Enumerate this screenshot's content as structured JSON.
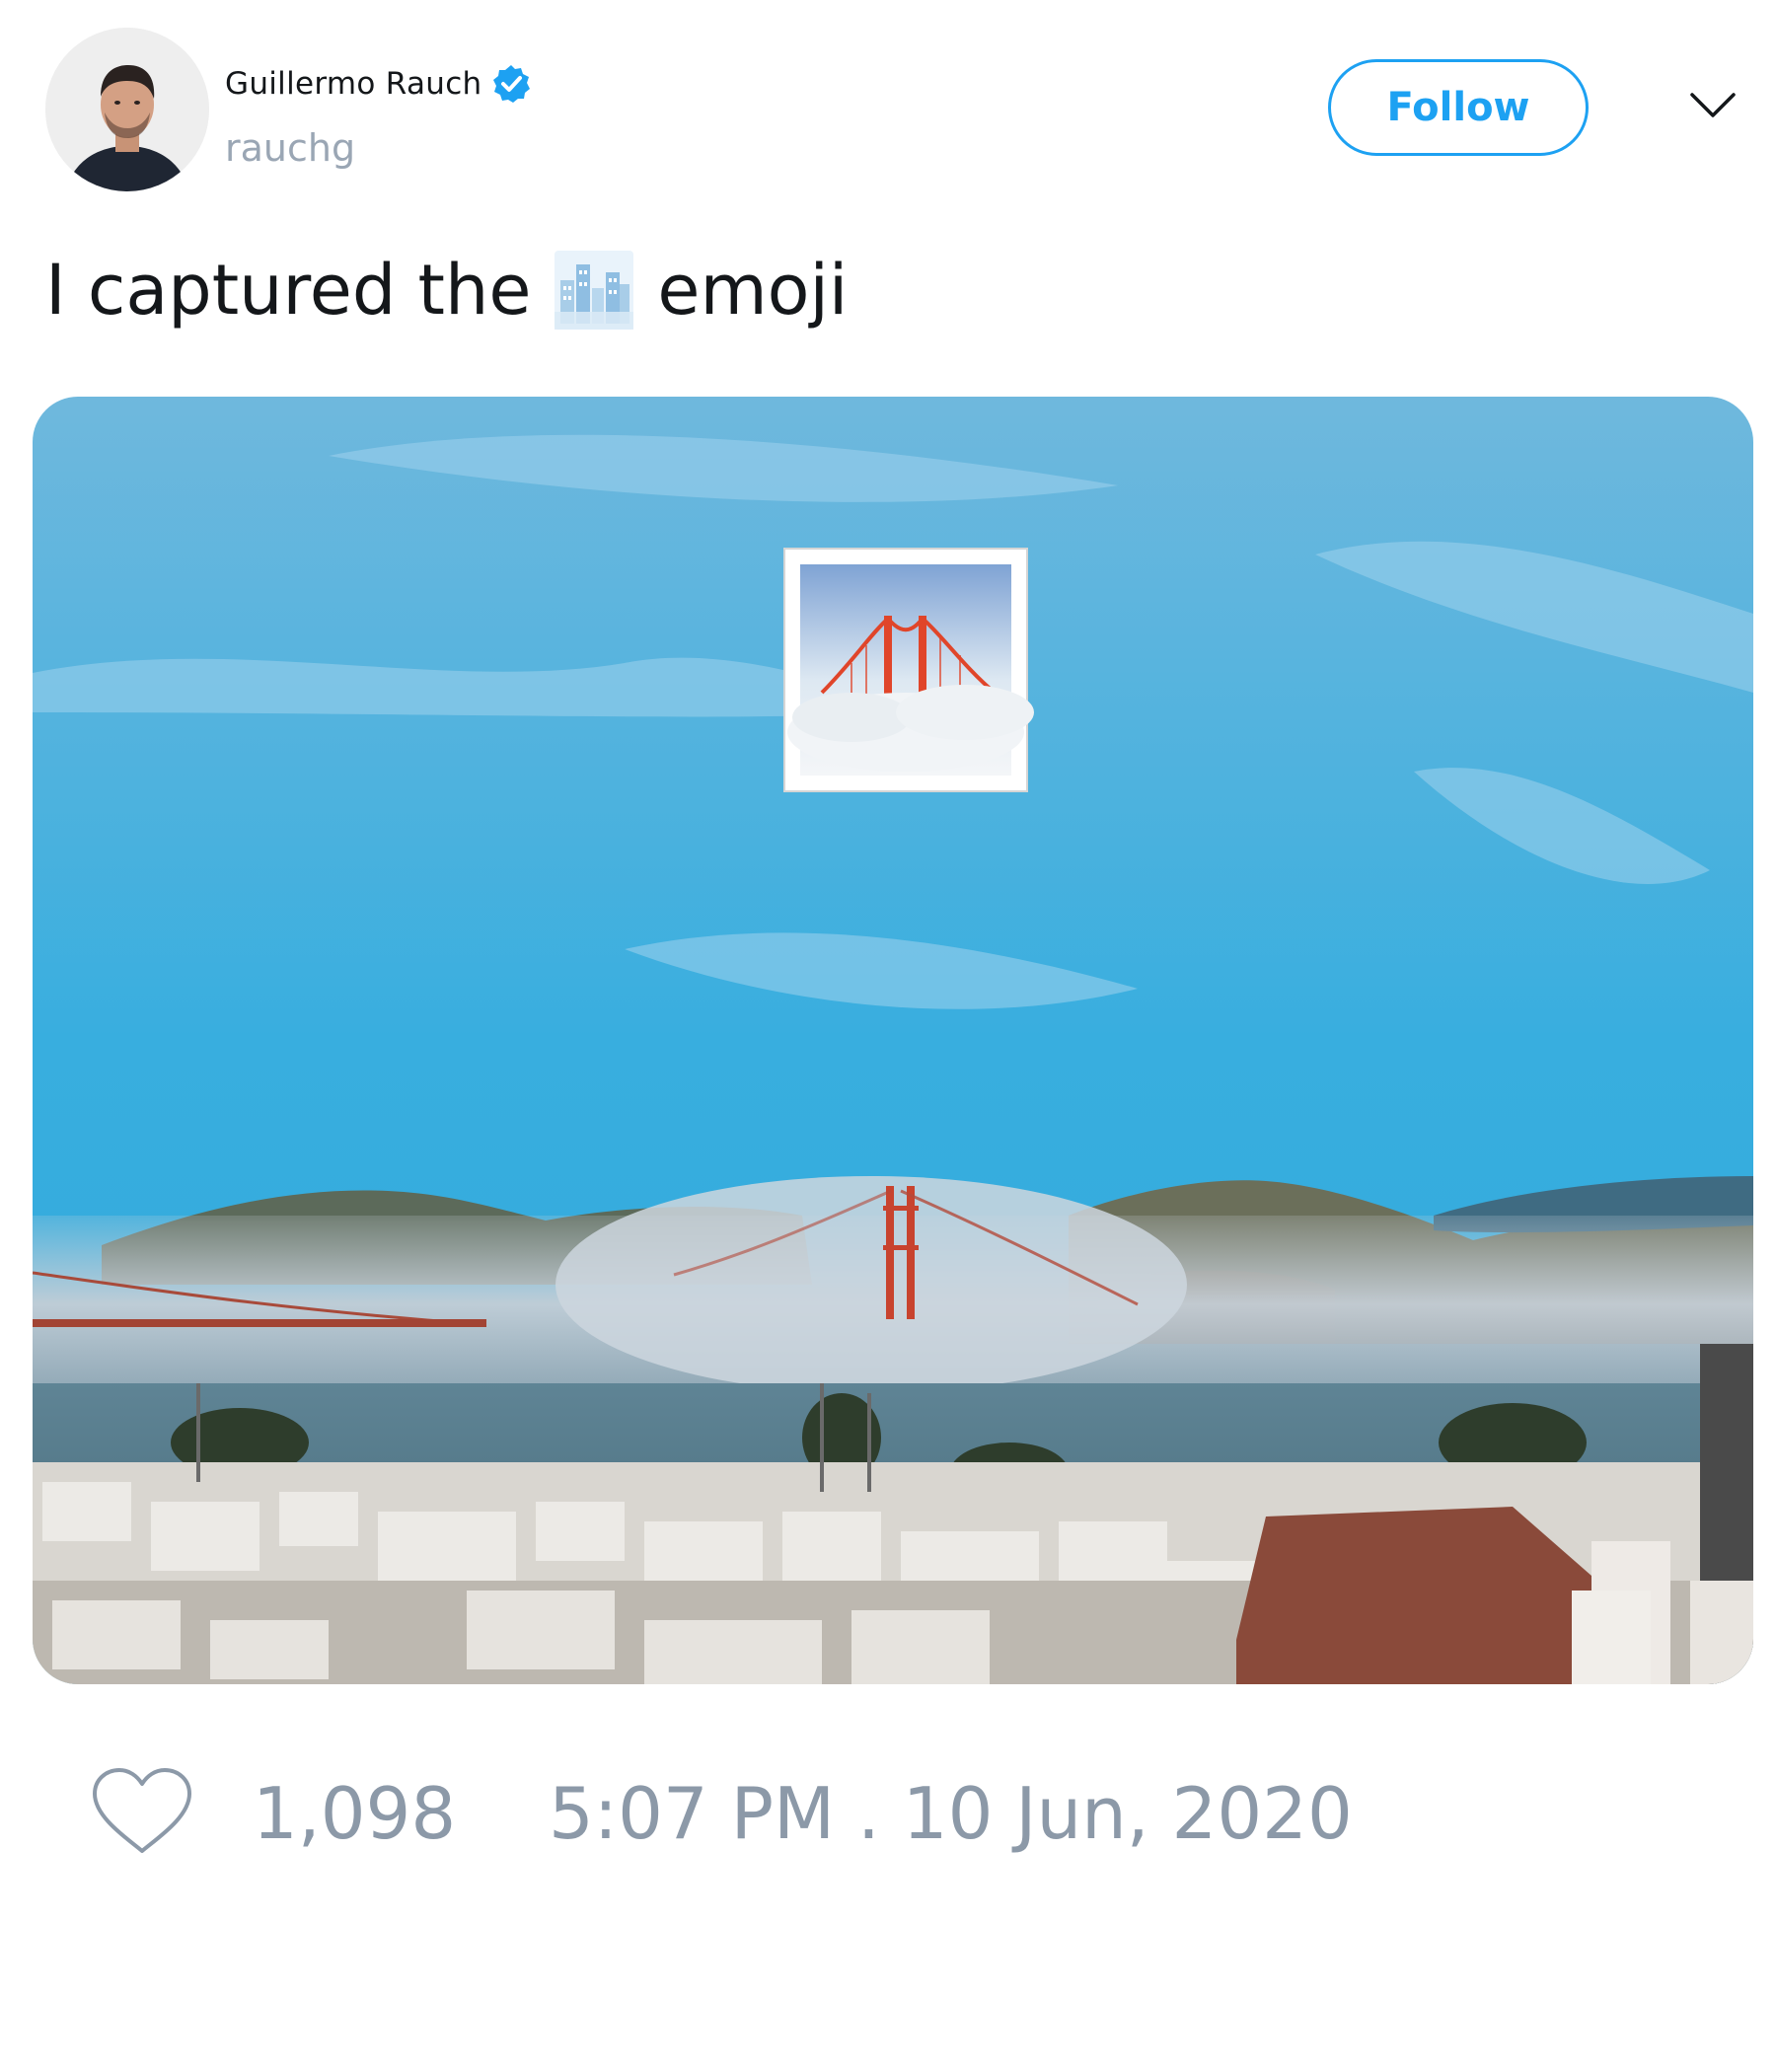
{
  "author": {
    "display_name": "Guillermo Rauch",
    "handle": "rauchg",
    "verified": true
  },
  "actions": {
    "follow_label": "Follow"
  },
  "tweet": {
    "text_before_emoji": "I captured the",
    "text_after_emoji": "emoji",
    "inline_emoji": "cityscape-emoji"
  },
  "stats": {
    "like_count": "1,098",
    "timestamp": "5:07 PM . 10 Jun, 2020"
  },
  "colors": {
    "accent": "#1da1f2",
    "muted_text": "#8c99a8",
    "handle_text": "#9aa6b4"
  },
  "icons": {
    "verified": "verified-badge-icon",
    "caret": "chevron-down-icon",
    "like": "heart-outline-icon",
    "photo_overlay": "foggy-bridge-emoji"
  }
}
